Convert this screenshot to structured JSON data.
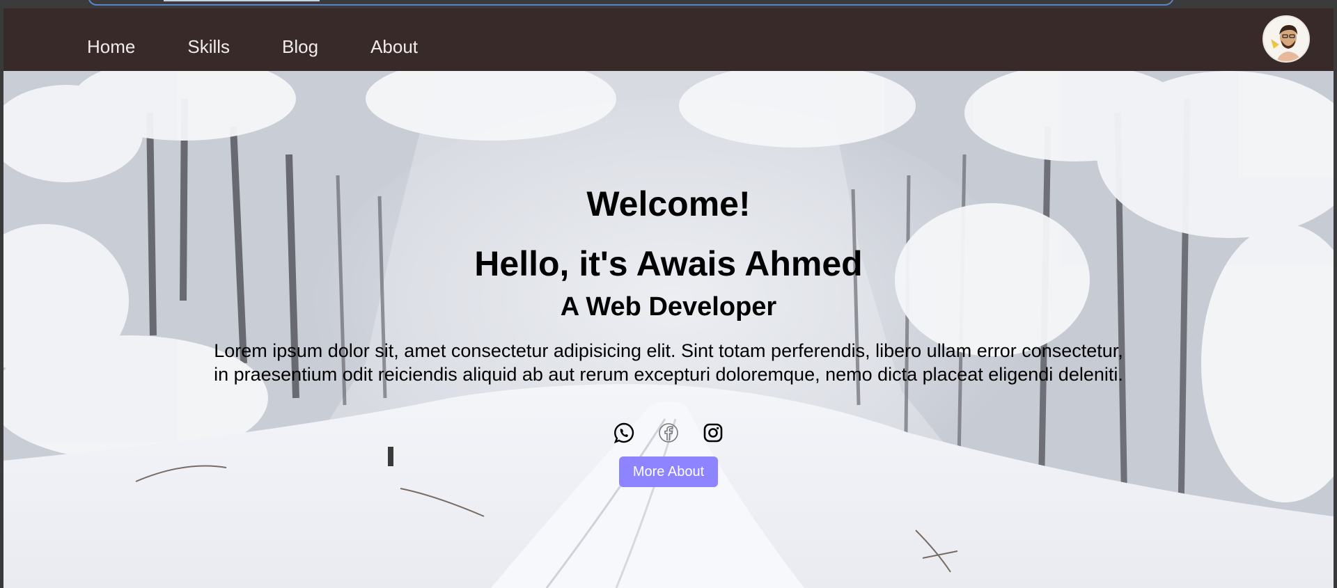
{
  "nav": {
    "items": [
      {
        "label": "Home"
      },
      {
        "label": "Skills"
      },
      {
        "label": "Blog"
      },
      {
        "label": "About"
      }
    ],
    "avatar_icon": "user-avatar"
  },
  "hero": {
    "welcome": "Welcome!",
    "greeting": "Hello, it's Awais Ahmed",
    "role": "A Web Developer",
    "intro": "Lorem ipsum dolor sit, amet consectetur adipisicing elit. Sint totam perferendis, libero ullam error consectetur, in praesentium odit reiciendis aliquid ab aut rerum excepturi doloremque, nemo dicta placeat eligendi deleniti.",
    "socials": [
      {
        "icon": "whatsapp-icon"
      },
      {
        "icon": "facebook-icon"
      },
      {
        "icon": "instagram-icon"
      }
    ],
    "button_label": "More About",
    "button_color": "#8f84ff"
  },
  "colors": {
    "navbar": "#392a2a",
    "nav_text": "#f1ecec"
  }
}
